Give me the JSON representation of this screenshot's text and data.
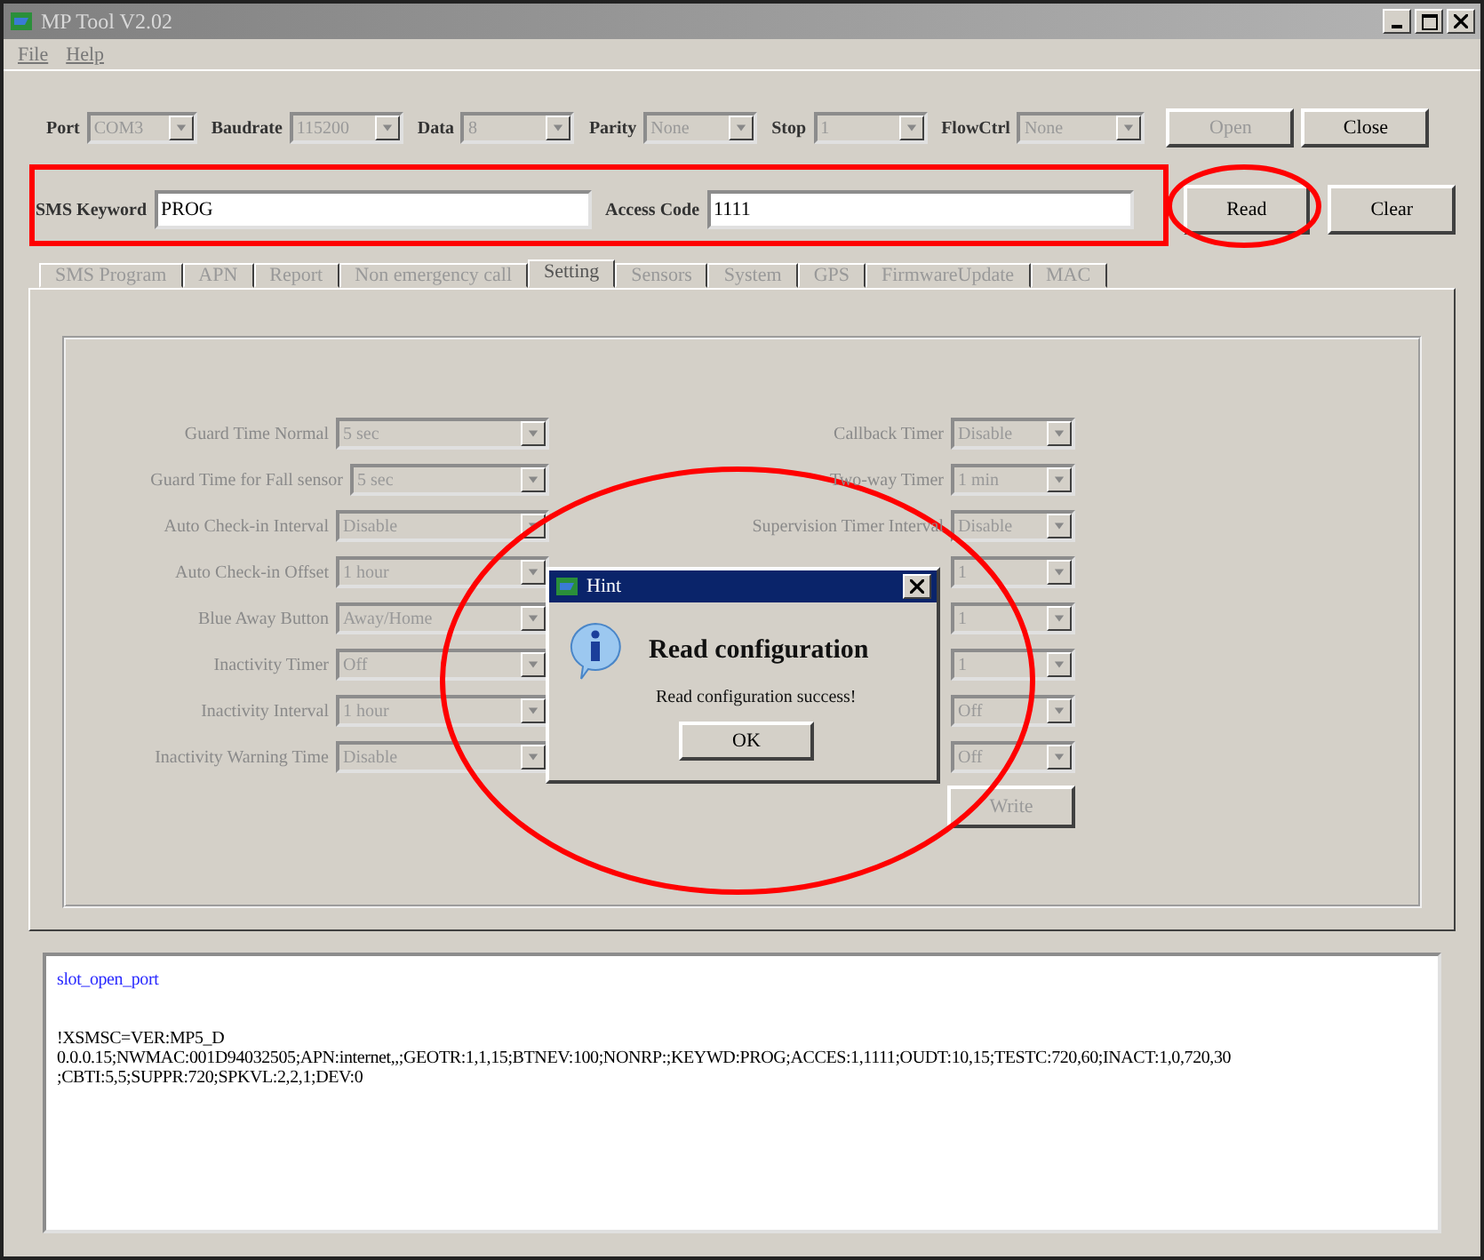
{
  "window": {
    "title": "MP Tool V2.02"
  },
  "menu": [
    "File",
    "Help"
  ],
  "connection": {
    "disabled": true,
    "fields": [
      {
        "label": "Port",
        "value": "COM3"
      },
      {
        "label": "Baudrate",
        "value": "115200"
      },
      {
        "label": "Data",
        "value": "8"
      },
      {
        "label": "Parity",
        "value": "None"
      },
      {
        "label": "Stop",
        "value": "1"
      },
      {
        "label": "FlowCtrl",
        "value": "None"
      }
    ],
    "buttons": [
      {
        "label": "Open",
        "disabled": true
      },
      {
        "label": "Close",
        "disabled": false
      }
    ]
  },
  "keyword": {
    "sms_keyword_label": "SMS Keyword",
    "sms_keyword": "PROG",
    "access_code_label": "Access Code",
    "access_code": "1111",
    "buttons": [
      "Read",
      "Clear"
    ]
  },
  "tabs": [
    {
      "label": "SMS Program",
      "selected": false
    },
    {
      "label": "APN",
      "selected": false
    },
    {
      "label": "Report",
      "selected": false
    },
    {
      "label": "Non emergency call",
      "selected": false
    },
    {
      "label": "Setting",
      "selected": true
    },
    {
      "label": "Sensors",
      "selected": false
    },
    {
      "label": "System",
      "selected": false
    },
    {
      "label": "GPS",
      "selected": false
    },
    {
      "label": "FirmwareUpdate",
      "selected": false
    },
    {
      "label": "MAC",
      "selected": false
    }
  ],
  "settings": {
    "disabled": true,
    "left": [
      {
        "label": "Guard Time Normal",
        "value": "5 sec"
      },
      {
        "label": "Guard Time for Fall sensor",
        "value": "5 sec"
      },
      {
        "label": "Auto Check-in Interval",
        "value": "Disable"
      },
      {
        "label": "Auto Check-in Offset",
        "value": "1 hour"
      },
      {
        "label": "Blue Away Button",
        "value": "Away/Home"
      },
      {
        "label": "Inactivity Timer",
        "value": "Off"
      },
      {
        "label": "Inactivity Interval",
        "value": "1 hour"
      },
      {
        "label": "Inactivity Warning Time",
        "value": "Disable"
      }
    ],
    "right": [
      {
        "label": "Callback Timer",
        "value": "Disable"
      },
      {
        "label": "Two-way Timer",
        "value": "1 min"
      },
      {
        "label": "Supervision Timer Interval",
        "value": "Disable"
      },
      {
        "value": "1"
      },
      {
        "value": "1"
      },
      {
        "value": "1"
      },
      {
        "value": "Off"
      },
      {
        "value": "Off"
      }
    ],
    "write_button": "Write"
  },
  "dialog": {
    "title": "Hint",
    "heading": "Read configuration",
    "message": "Read configuration success!",
    "button": "OK"
  },
  "log": {
    "lines": [
      {
        "kind": "status",
        "text": "slot_open_port"
      },
      {
        "kind": "data",
        "text": "!XSMSC=VER:MP5_D"
      },
      {
        "kind": "data",
        "text": "0.0.0.15;NWMAC:001D94032505;APN:internet,,;GEOTR:1,1,15;BTNEV:100;NONRP:;KEYWD:PROG;ACCES:1,1111;OUDT:10,15;TESTC:720,60;INACT:1,0,720,30"
      },
      {
        "kind": "data",
        "text": ";CBTI:5,5;SUPPR:720;SPKVL:2,2,1;DEV:0"
      }
    ]
  }
}
